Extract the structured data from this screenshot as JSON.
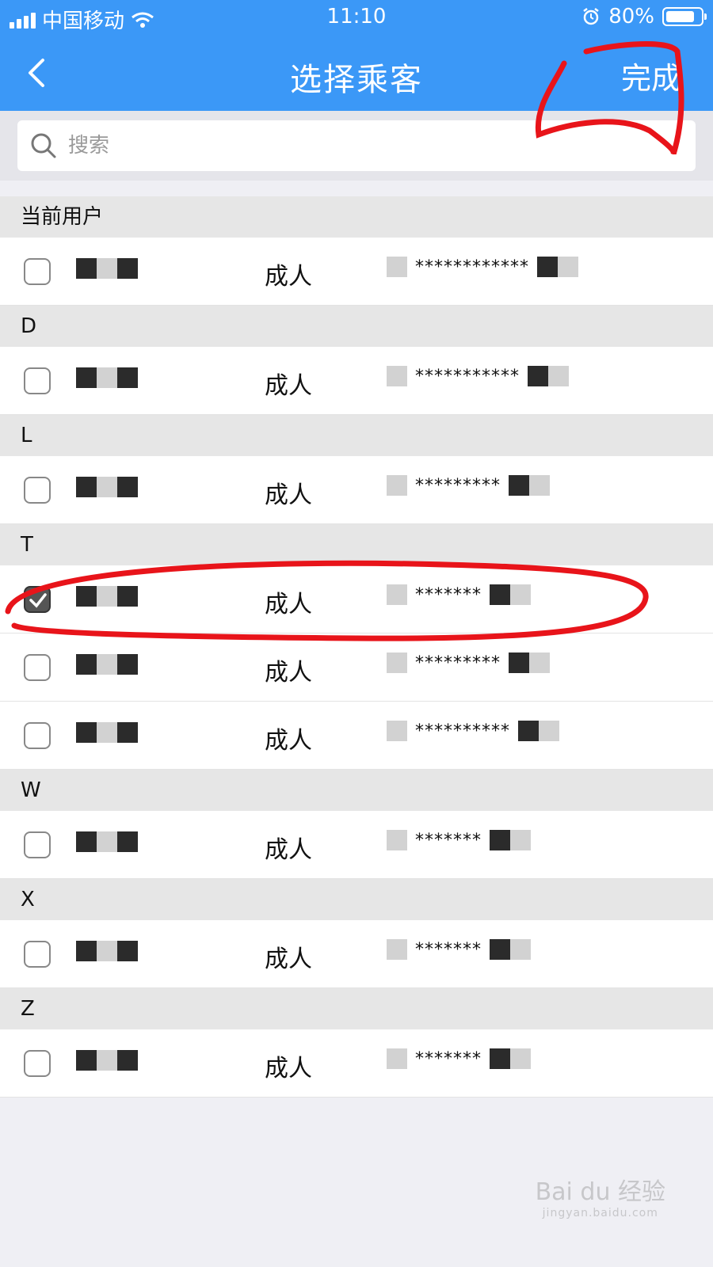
{
  "status_bar": {
    "carrier": "中国移动",
    "time": "11:10",
    "battery_percent": "80%",
    "battery_level": 0.8
  },
  "nav": {
    "back_icon": "chevron-left-icon",
    "title": "选择乘客",
    "done_label": "完成"
  },
  "search": {
    "placeholder": "搜索"
  },
  "colors": {
    "header_bg": "#3b98f7",
    "annotation": "#e8141a"
  },
  "sections": [
    {
      "header": "当前用户",
      "passengers": [
        {
          "type": "成人",
          "id_masked": "************",
          "checked": false
        }
      ]
    },
    {
      "header": "D",
      "passengers": [
        {
          "type": "成人",
          "id_masked": "***********",
          "checked": false
        }
      ]
    },
    {
      "header": "L",
      "passengers": [
        {
          "type": "成人",
          "id_masked": "*********",
          "checked": false
        }
      ]
    },
    {
      "header": "T",
      "passengers": [
        {
          "type": "成人",
          "id_masked": "*******",
          "checked": true
        },
        {
          "type": "成人",
          "id_masked": "*********",
          "checked": false
        },
        {
          "type": "成人",
          "id_masked": "**********",
          "checked": false
        }
      ]
    },
    {
      "header": "W",
      "passengers": [
        {
          "type": "成人",
          "id_masked": "*******",
          "checked": false
        }
      ]
    },
    {
      "header": "X",
      "passengers": [
        {
          "type": "成人",
          "id_masked": "*******",
          "checked": false
        }
      ]
    },
    {
      "header": "Z",
      "passengers": [
        {
          "type": "成人",
          "id_masked": "*******",
          "checked": false
        }
      ]
    }
  ],
  "watermark": {
    "brand": "Bai du 经验",
    "url": "jingyan.baidu.com"
  }
}
